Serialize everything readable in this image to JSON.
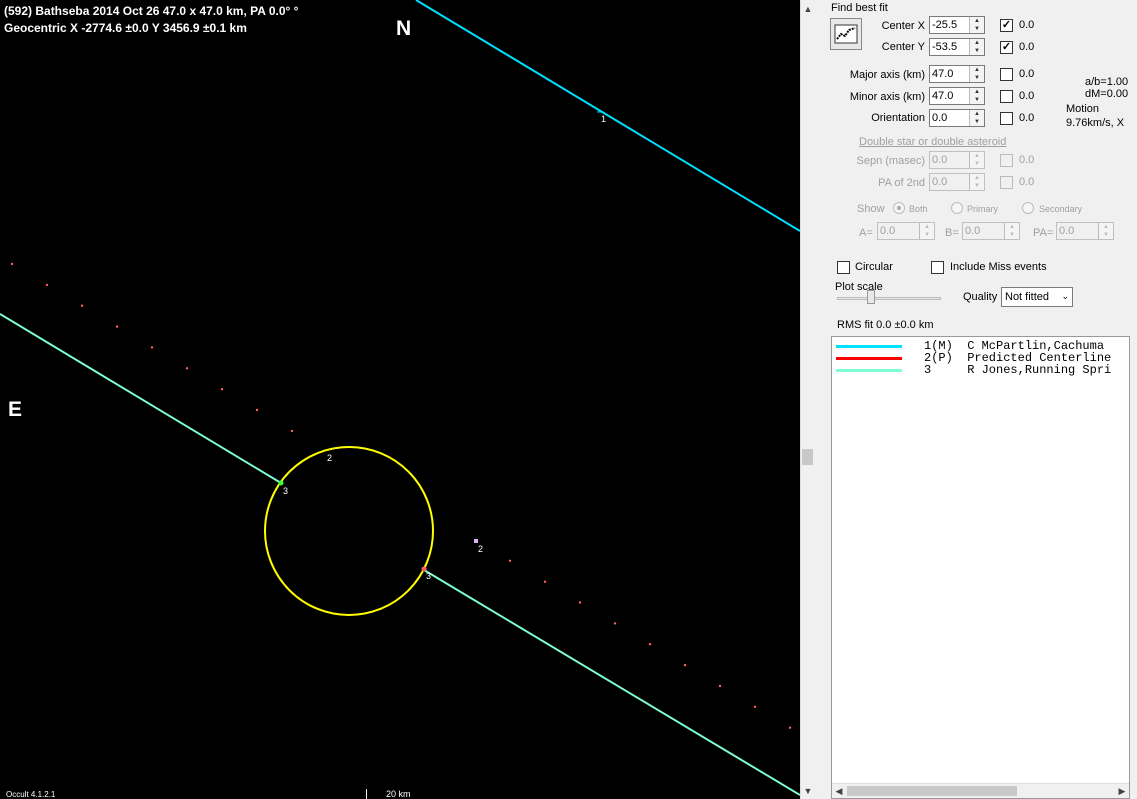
{
  "plot": {
    "title_line1": "(592) Bathseba  2014 Oct 26   47.0 x 47.0 km,  PA 0.0° °",
    "title_line2": "Geocentric  X  -2774.6 ±0.0  Y 3456.9 ±0.1 km",
    "north_label": "N",
    "east_label": "E",
    "chord_labels": [
      "1",
      "2",
      "3",
      "2",
      "3"
    ],
    "version": "Occult 4.1.2.1",
    "scale_label": "20 km",
    "colors": {
      "chord1": "#00e0ff",
      "chord3": "#7dffcf",
      "ellipse": "#ffff00",
      "predicted": "#ff6060"
    }
  },
  "panel": {
    "find_best_fit": "Find best fit",
    "center_x": {
      "label": "Center X",
      "value": "-25.5",
      "checked": true,
      "uncert": "0.0"
    },
    "center_y": {
      "label": "Center Y",
      "value": "-53.5",
      "checked": true,
      "uncert": "0.0"
    },
    "major_axis": {
      "label": "Major axis (km)",
      "value": "47.0",
      "checked": false,
      "uncert": "0.0"
    },
    "minor_axis": {
      "label": "Minor axis (km)",
      "value": "47.0",
      "checked": false,
      "uncert": "0.0"
    },
    "orientation": {
      "label": "Orientation",
      "value": "0.0",
      "checked": false,
      "uncert": "0.0"
    },
    "ab_ratio": "a/b=1.00",
    "dm": "dM=0.00",
    "motion_label": "Motion",
    "motion_value": "9.76km/s, X",
    "double_star_link": "Double star  or  double asteroid",
    "sepn": {
      "label": "Sepn (masec)",
      "value": "0.0",
      "uncert": "0.0"
    },
    "pa2nd": {
      "label": "PA of 2nd",
      "value": "0.0",
      "uncert": "0.0"
    },
    "show_label": "Show",
    "radio_both": "Both",
    "radio_primary": "Primary",
    "radio_secondary": "Secondary",
    "a_label": "A=",
    "a_value": "0.0",
    "b_label": "B=",
    "b_value": "0.0",
    "pa_label": "PA=",
    "pa_value": "0.0",
    "circular": "Circular",
    "include_miss": "Include Miss events",
    "plot_scale": "Plot scale",
    "quality_label": "Quality",
    "quality_value": "Not fitted",
    "rms_fit": "RMS fit 0.0 ±0.0 km",
    "legend": [
      {
        "text": "1(M)  C McPartlin,Cachuma",
        "color": "#00e0ff"
      },
      {
        "text": "2(P)  Predicted Centerline",
        "color": "#ff0000"
      },
      {
        "text": "3     R Jones,Running Spri",
        "color": "#7dffcf"
      }
    ]
  }
}
